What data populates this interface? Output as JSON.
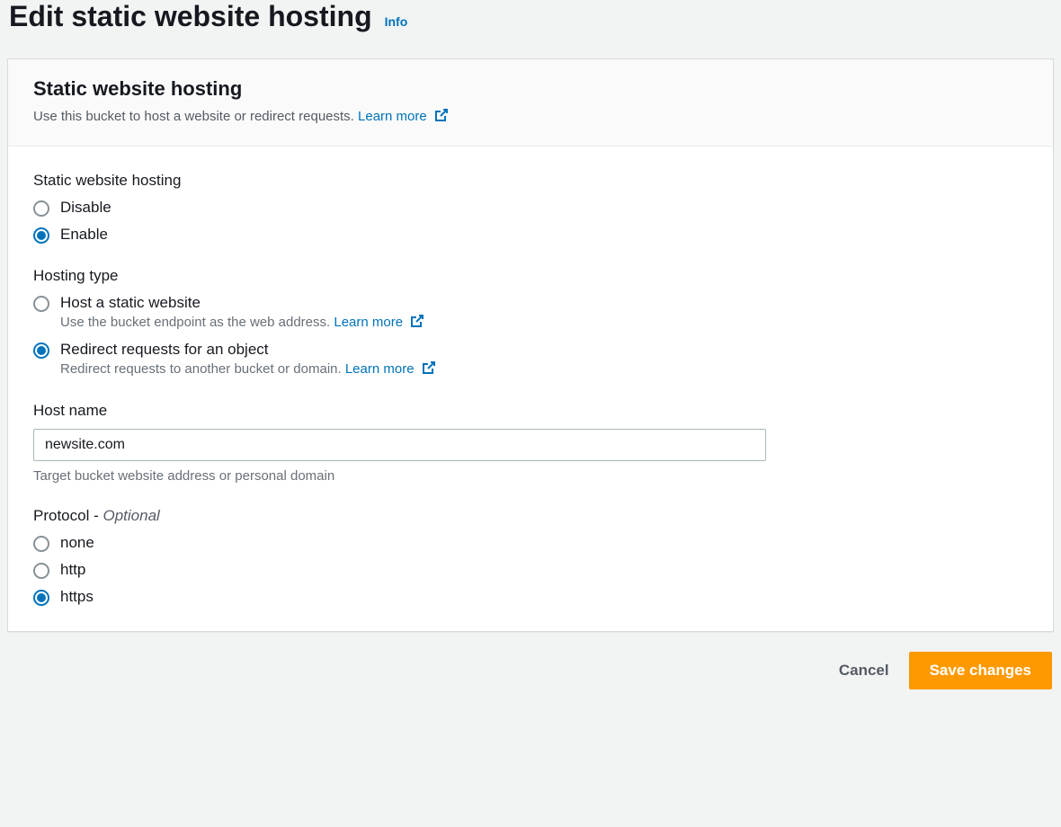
{
  "header": {
    "title": "Edit static website hosting",
    "info_label": "Info"
  },
  "panel": {
    "title": "Static website hosting",
    "description": "Use this bucket to host a website or redirect requests.",
    "learn_more": "Learn more"
  },
  "hosting_toggle": {
    "label": "Static website hosting",
    "disable": "Disable",
    "enable": "Enable"
  },
  "hosting_type": {
    "label": "Hosting type",
    "option_static": {
      "label": "Host a static website",
      "desc": "Use the bucket endpoint as the web address.",
      "learn_more": "Learn more"
    },
    "option_redirect": {
      "label": "Redirect requests for an object",
      "desc": "Redirect requests to another bucket or domain.",
      "learn_more": "Learn more"
    }
  },
  "host_name": {
    "label": "Host name",
    "value": "newsite.com",
    "hint": "Target bucket website address or personal domain"
  },
  "protocol": {
    "label_main": "Protocol - ",
    "label_optional": "Optional",
    "none": "none",
    "http": "http",
    "https": "https"
  },
  "footer": {
    "cancel": "Cancel",
    "save": "Save changes"
  }
}
